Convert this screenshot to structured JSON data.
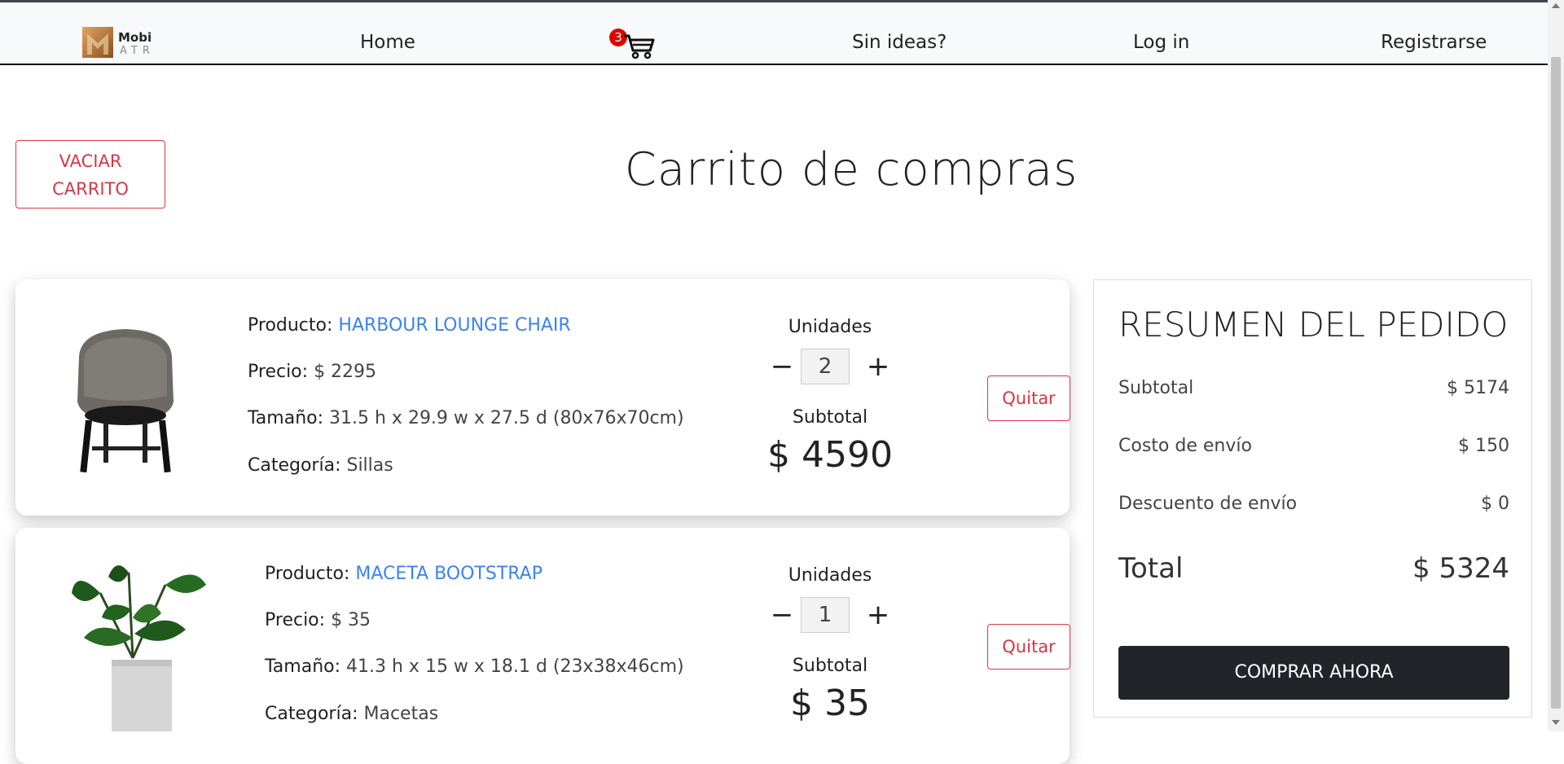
{
  "nav": {
    "logo_text_top": "Mobi",
    "logo_text_bottom": "ATR",
    "home": "Home",
    "cart_count": "3",
    "ideas": "Sin ideas?",
    "login": "Log in",
    "register": "Registrarse"
  },
  "header": {
    "empty_cart_label_line1": "VACIAR",
    "empty_cart_label_line2": "CARRITO",
    "title": "Carrito de compras"
  },
  "labels": {
    "product": "Producto:",
    "price": "Precio:",
    "size": "Tamaño:",
    "category": "Categoría:",
    "units": "Unidades",
    "subtotal": "Subtotal",
    "remove": "Quitar",
    "minus": "−",
    "plus": "+"
  },
  "items": [
    {
      "name": "HARBOUR LOUNGE CHAIR",
      "price": "$ 2295",
      "size": "31.5 h x 29.9 w x 27.5 d (80x76x70cm)",
      "category": "Sillas",
      "quantity": "2",
      "subtotal": "$ 4590"
    },
    {
      "name": "MACETA BOOTSTRAP",
      "price": "$ 35",
      "size": "41.3 h x 15 w x 18.1 d (23x38x46cm)",
      "category": "Macetas",
      "quantity": "1",
      "subtotal": "$ 35"
    }
  ],
  "summary": {
    "title": "RESUMEN DEL PEDIDO",
    "subtotal_label": "Subtotal",
    "subtotal_value": "$ 5174",
    "shipping_label": "Costo de envío",
    "shipping_value": "$ 150",
    "discount_label": "Descuento de envío",
    "discount_value": "$ 0",
    "total_label": "Total",
    "total_value": "$ 5324",
    "buy_label": "COMPRAR AHORA"
  },
  "colors": {
    "accent_red": "#dc3545",
    "link_blue": "#3b82f6",
    "dark_button": "#212529",
    "badge_red": "#e00000"
  }
}
